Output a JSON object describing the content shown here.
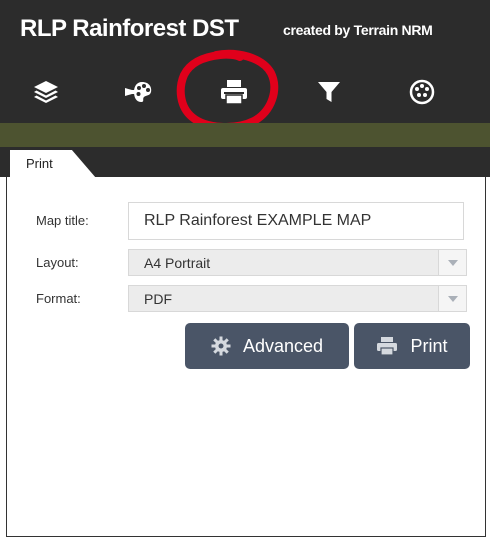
{
  "header": {
    "title": "RLP Rainforest DST",
    "credit": "created by Terrain NRM"
  },
  "toolbar": {
    "tools": [
      {
        "icon": "layers-icon"
      },
      {
        "icon": "legend-icon"
      },
      {
        "icon": "print-icon",
        "highlighted": true
      },
      {
        "icon": "filter-icon"
      },
      {
        "icon": "basemap-icon"
      }
    ]
  },
  "panel": {
    "tab_label": "Print",
    "form": {
      "map_title_label": "Map title:",
      "map_title_value": "RLP Rainforest EXAMPLE MAP",
      "layout_label": "Layout:",
      "layout_value": "A4 Portrait",
      "format_label": "Format:",
      "format_value": "PDF"
    },
    "buttons": {
      "advanced_label": "Advanced",
      "print_label": "Print"
    }
  },
  "colors": {
    "header_bg": "#2c2c2c",
    "olive_bar": "#4d5330",
    "button_bg": "#4a5567",
    "highlight": "#e0001b"
  }
}
